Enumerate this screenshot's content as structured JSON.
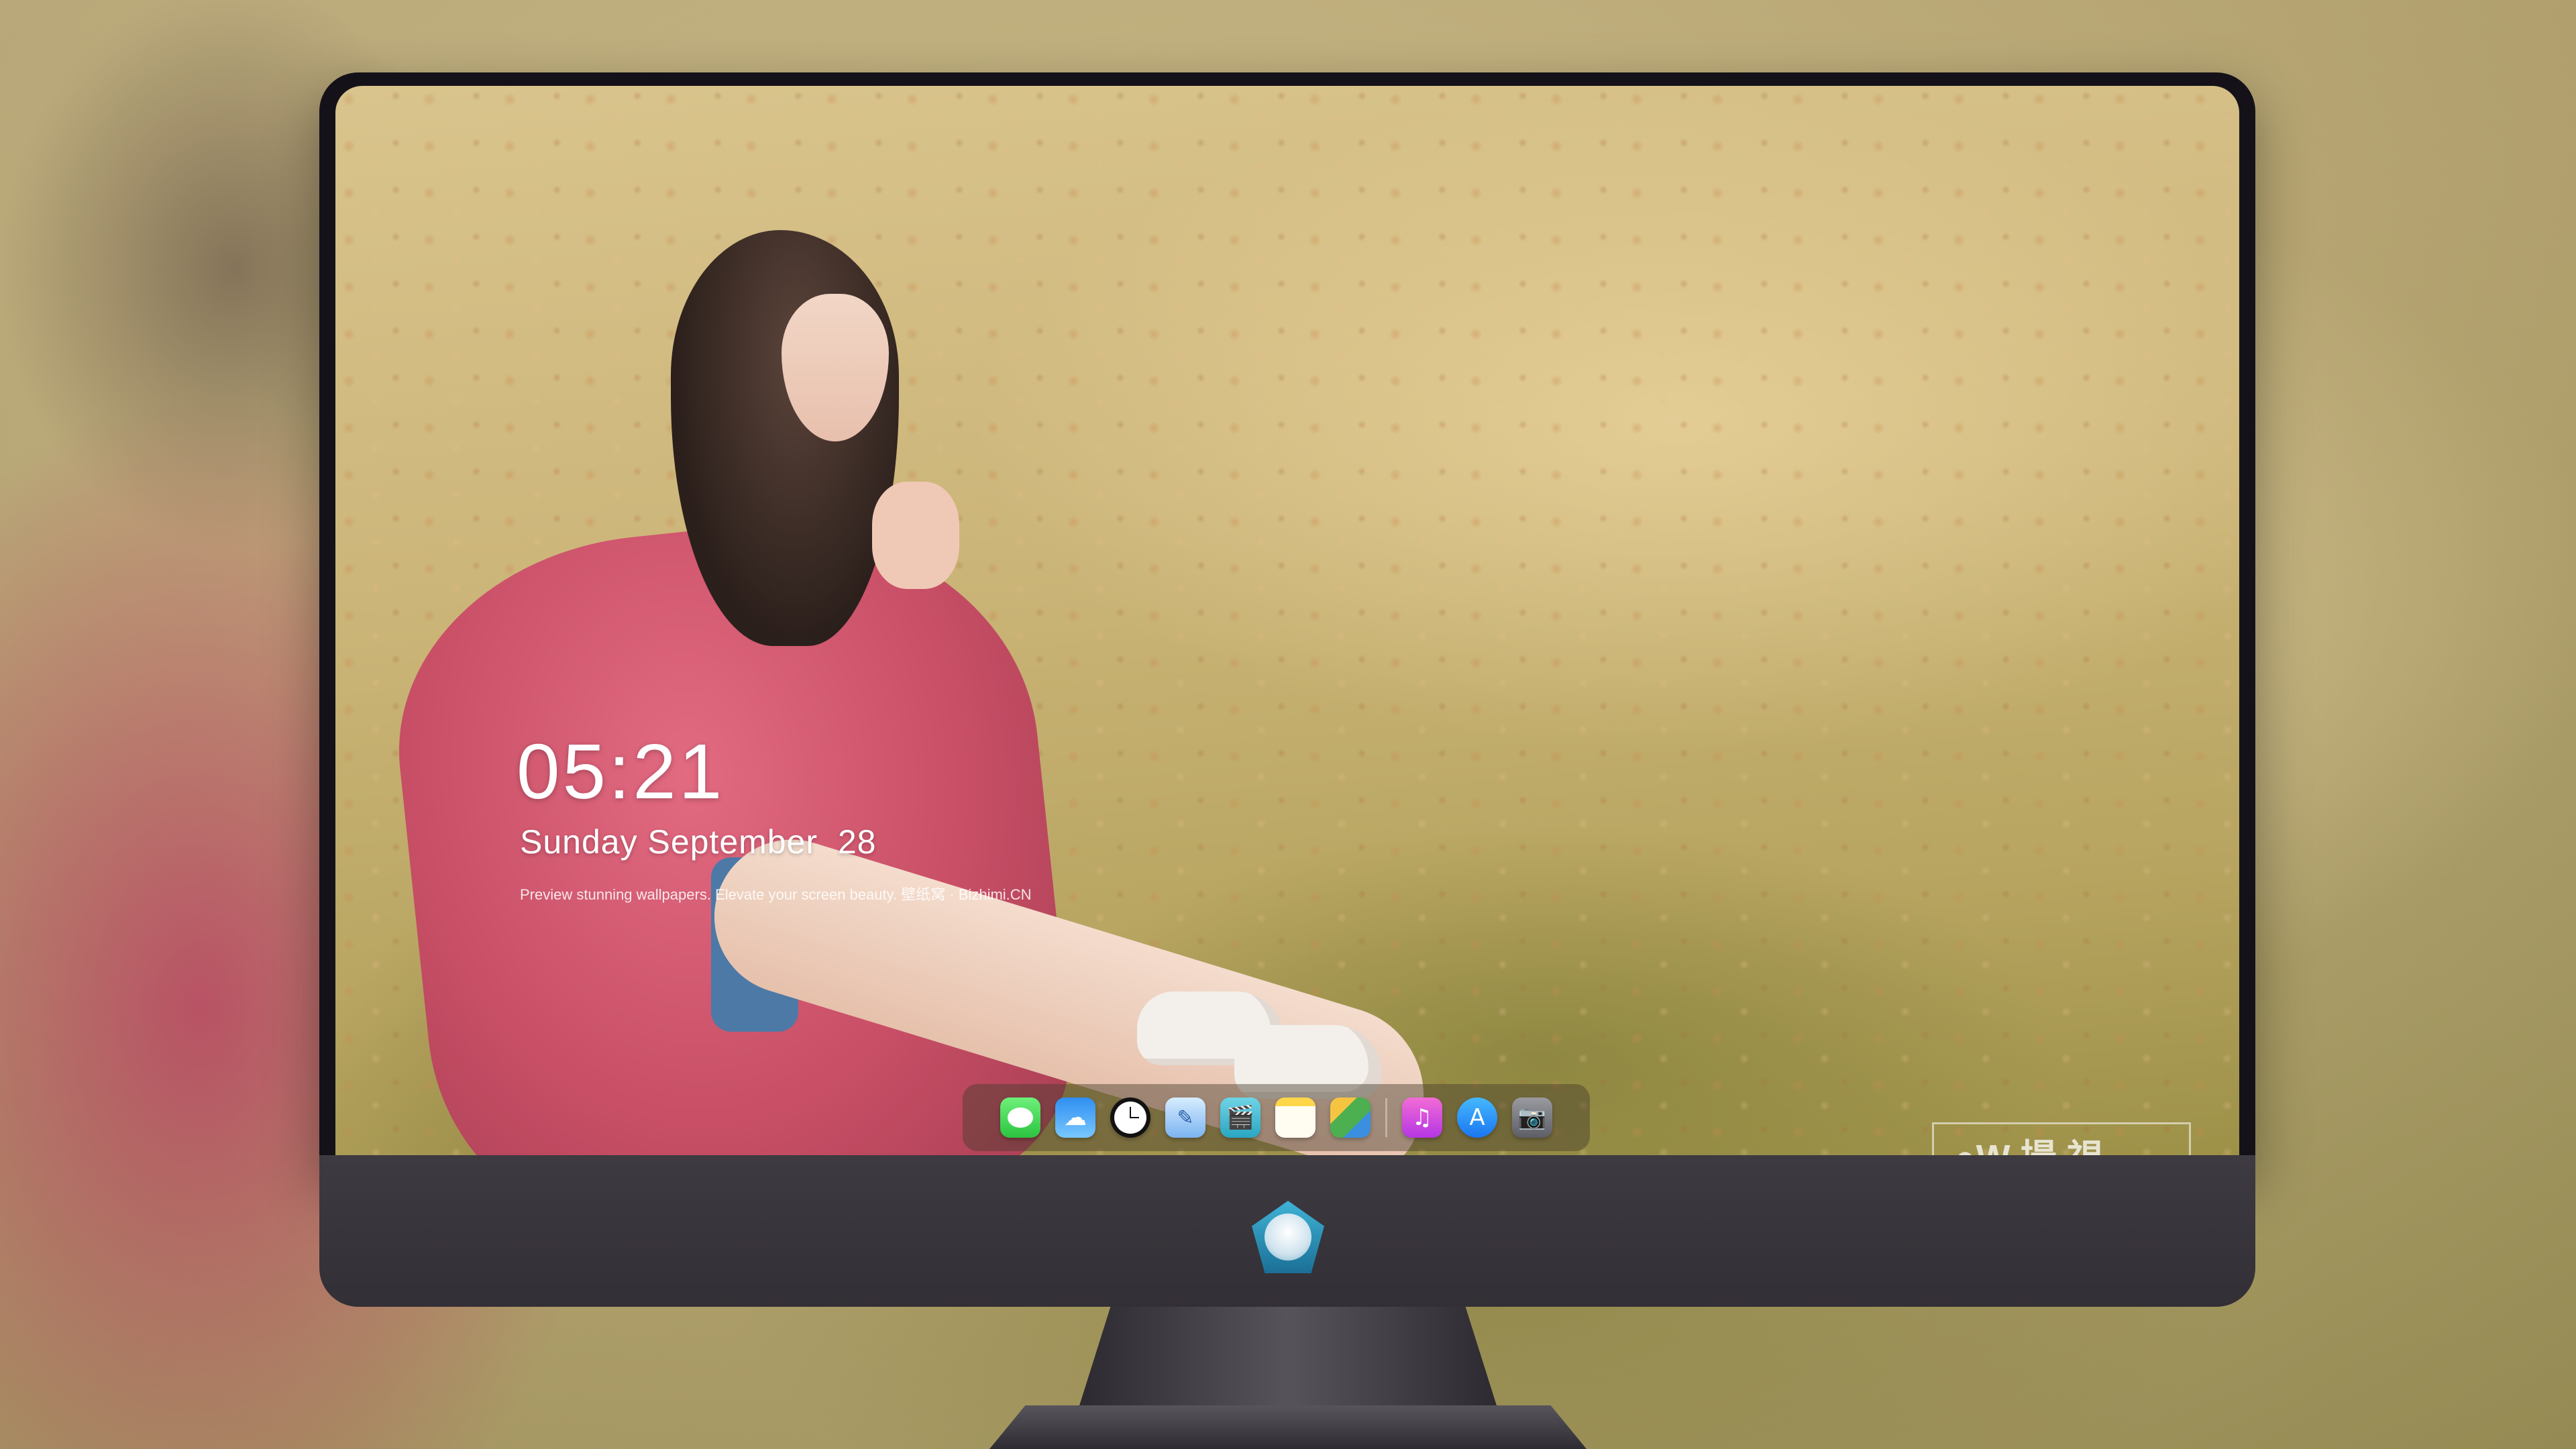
{
  "lockscreen": {
    "time": "05:21",
    "date": "Sunday September  28",
    "tagline": "Preview stunning wallpapers. Elevate your screen beauty. 壁纸窝 · Bizhimi.CN"
  },
  "dock": {
    "icons": [
      {
        "name": "messages-icon",
        "glyph": ""
      },
      {
        "name": "weather-icon",
        "glyph": "☁"
      },
      {
        "name": "clock-icon",
        "glyph": ""
      },
      {
        "name": "preview-icon",
        "glyph": "✎"
      },
      {
        "name": "clapper-icon",
        "glyph": "🎬"
      },
      {
        "name": "notes-icon",
        "glyph": ""
      },
      {
        "name": "photos-icon",
        "glyph": ""
      },
      {
        "name": "music-icon",
        "glyph": "♫"
      },
      {
        "name": "appstore-icon",
        "glyph": "A"
      },
      {
        "name": "camera-icon",
        "glyph": "📷"
      }
    ]
  },
  "watermark": {
    "text": "●W 撮 視"
  },
  "colors": {
    "bezel": "#141218",
    "chin": "#3e3a41",
    "sweater": "#d85b73",
    "lawn": "#c9b37a"
  }
}
